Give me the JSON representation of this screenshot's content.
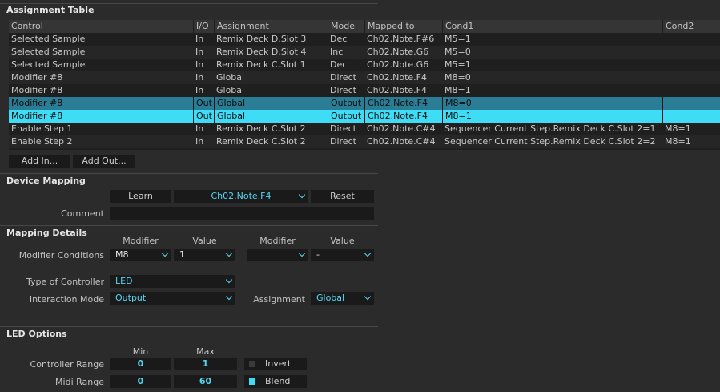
{
  "assignment_table": {
    "title": "Assignment Table",
    "columns": [
      "Control",
      "I/O",
      "Assignment",
      "Mode",
      "Mapped to",
      "Cond1",
      "Cond2"
    ],
    "rows": [
      {
        "control": "Selected Sample",
        "io": "In",
        "assignment": "Remix Deck D.Slot 3",
        "mode": "Dec",
        "mapped": "Ch02.Note.F#6",
        "cond1": "M5=1",
        "cond2": "",
        "state": "normal"
      },
      {
        "control": "Selected Sample",
        "io": "In",
        "assignment": "Remix Deck D.Slot 4",
        "mode": "Inc",
        "mapped": "Ch02.Note.G6",
        "cond1": "M5=0",
        "cond2": "",
        "state": "alt"
      },
      {
        "control": "Selected Sample",
        "io": "In",
        "assignment": "Remix Deck C.Slot 1",
        "mode": "Dec",
        "mapped": "Ch02.Note.G6",
        "cond1": "M5=1",
        "cond2": "",
        "state": "normal"
      },
      {
        "control": "Modifier #8",
        "io": "In",
        "assignment": "Global",
        "mode": "Direct",
        "mapped": "Ch02.Note.F4",
        "cond1": "M8=0",
        "cond2": "",
        "state": "alt"
      },
      {
        "control": "Modifier #8",
        "io": "In",
        "assignment": "Global",
        "mode": "Direct",
        "mapped": "Ch02.Note.F4",
        "cond1": "M8=1",
        "cond2": "",
        "state": "normal"
      },
      {
        "control": "Modifier #8",
        "io": "Out",
        "assignment": "Global",
        "mode": "Output",
        "mapped": "Ch02.Note.F4",
        "cond1": "M8=0",
        "cond2": "",
        "state": "sel-dark"
      },
      {
        "control": "Modifier #8",
        "io": "Out",
        "assignment": "Global",
        "mode": "Output",
        "mapped": "Ch02.Note.F4",
        "cond1": "M8=1",
        "cond2": "",
        "state": "sel-light"
      },
      {
        "control": "Enable Step 1",
        "io": "In",
        "assignment": "Remix Deck C.Slot 2",
        "mode": "Direct",
        "mapped": "Ch02.Note.C#4",
        "cond1": "Sequencer Current Step.Remix Deck C.Slot 2=1",
        "cond2": "M8=1",
        "state": "normal"
      },
      {
        "control": "Enable Step 2",
        "io": "In",
        "assignment": "Remix Deck C.Slot 2",
        "mode": "Direct",
        "mapped": "Ch02.Note.C#4",
        "cond1": "Sequencer Current Step.Remix Deck C.Slot 2=2",
        "cond2": "M8=1",
        "state": "alt"
      }
    ],
    "add_in_label": "Add In...",
    "add_out_label": "Add Out..."
  },
  "device_mapping": {
    "title": "Device Mapping",
    "learn_label": "Learn",
    "mapped_value": "Ch02.Note.F4",
    "reset_label": "Reset",
    "comment_label": "Comment",
    "comment_value": ""
  },
  "mapping_details": {
    "title": "Mapping Details",
    "modifier_header": "Modifier",
    "value_header": "Value",
    "modifier_conditions_label": "Modifier Conditions",
    "mod1": "M8",
    "val1": "1",
    "mod2": "",
    "val2": "-",
    "type_of_controller_label": "Type of Controller",
    "type_of_controller": "LED",
    "interaction_mode_label": "Interaction Mode",
    "interaction_mode": "Output",
    "assignment_label": "Assignment",
    "assignment": "Global"
  },
  "led_options": {
    "title": "LED Options",
    "min_header": "Min",
    "max_header": "Max",
    "controller_range_label": "Controller Range",
    "controller_min": "0",
    "controller_max": "1",
    "invert_label": "Invert",
    "invert_checked": false,
    "midi_range_label": "Midi Range",
    "midi_min": "0",
    "midi_max": "60",
    "blend_label": "Blend",
    "blend_checked": true
  },
  "colors": {
    "accent": "#3fdcf5",
    "selected_dark": "#2a7d94",
    "background": "#2b2b2b"
  }
}
